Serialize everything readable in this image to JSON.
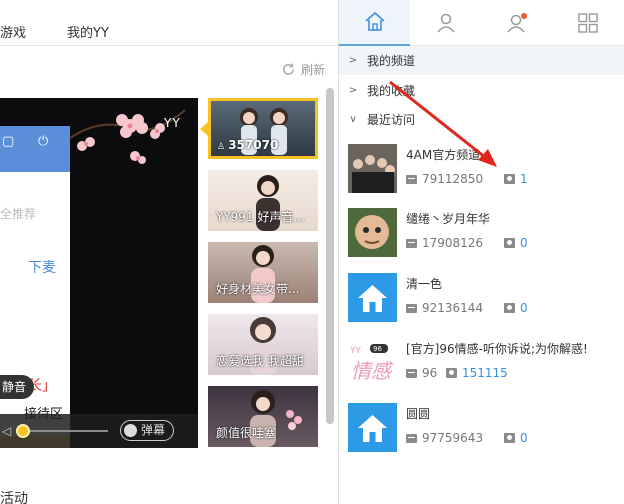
{
  "topnav": {
    "items": [
      "游戏",
      "我的YY"
    ],
    "refresh_label": "刷新"
  },
  "player": {
    "watermark": "YY",
    "screen_texts": [
      "全推荐",
      "下麦",
      "班组长」",
      "接待区"
    ],
    "mute_tooltip": "静音",
    "danmu_label": "弹幕"
  },
  "thumbnails": [
    {
      "caption": "357070",
      "active": true
    },
    {
      "caption": "YY991 好声音..."
    },
    {
      "caption": "好身材美女带..."
    },
    {
      "caption": "恋爱选我 我超甜"
    },
    {
      "caption": "颜值很哇塞"
    }
  ],
  "bottom_text": "活动",
  "right": {
    "tabs": [
      {
        "name": "home",
        "icon": "home-icon",
        "active": true
      },
      {
        "name": "contacts",
        "icon": "person-icon"
      },
      {
        "name": "notifications",
        "icon": "person-badge-icon"
      },
      {
        "name": "apps",
        "icon": "grid-icon"
      }
    ],
    "groups": [
      {
        "label": "我的频道",
        "expanded": false
      },
      {
        "label": "我的收藏",
        "expanded": false
      },
      {
        "label": "最近访问",
        "expanded": true
      }
    ],
    "recent_channels": [
      {
        "name": "4AM官方频道",
        "id": "79112850",
        "online": "1"
      },
      {
        "name": "缱绻丶岁月年华",
        "id": "17908126",
        "online": "0"
      },
      {
        "name": "清一色",
        "id": "92136144",
        "online": "0"
      },
      {
        "name": "[官方]96情感-听你诉说;为你解惑!",
        "id": "96",
        "online": "151115"
      },
      {
        "name": "圆圆",
        "id": "97759643",
        "online": "0"
      }
    ]
  },
  "colors": {
    "accent_blue": "#3a8ee6",
    "active_thumb_border": "#f8c227",
    "annotation_arrow": "#e0251b"
  }
}
